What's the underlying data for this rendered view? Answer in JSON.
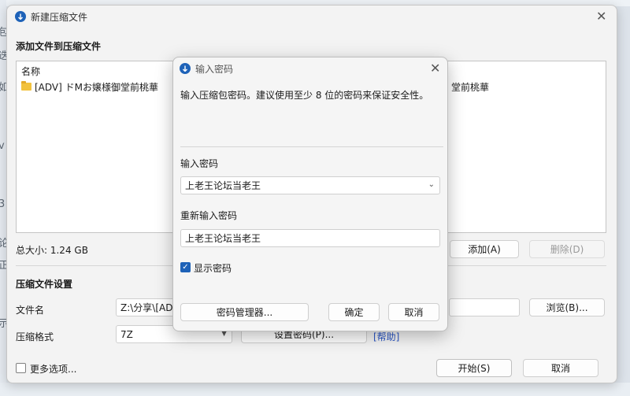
{
  "background": {
    "left_glyphs": [
      "包",
      "迭",
      "如",
      "v",
      "3",
      "论",
      "正",
      "示"
    ]
  },
  "main": {
    "title": "新建压缩文件",
    "section_add": "添加文件到压缩文件",
    "list_header_name": "名称",
    "file_item": "[ADV] ドMお嬢様御堂前桃華",
    "file_item_tail": "堂前桃華",
    "total_size": "总大小: 1.24 GB",
    "add_button": "添加(A)",
    "delete_button": "删除(D)",
    "section_settings": "压缩文件设置",
    "filename_label": "文件名",
    "filename_value": "Z:\\分享\\[ADV",
    "browse_button": "浏览(B)...",
    "format_label": "压缩格式",
    "format_value": "7Z",
    "set_password_button": "设置密码(P)...",
    "help_link": "[帮助]",
    "more_options": "更多选项...",
    "start_button": "开始(S)",
    "cancel_button": "取消"
  },
  "dialog": {
    "title": "输入密码",
    "description": "输入压缩包密码。建议使用至少 8 位的密码来保证安全性。",
    "password_label": "输入密码",
    "password_value": "上老王论坛当老王",
    "reenter_label": "重新输入密码",
    "reenter_value": "上老王论坛当老王",
    "show_password": "显示密码",
    "show_password_checked": true,
    "manager_button": "密码管理器...",
    "ok_button": "确定",
    "cancel_button": "取消"
  },
  "colors": {
    "accent": "#1e62b8",
    "link": "#2a56c6"
  }
}
